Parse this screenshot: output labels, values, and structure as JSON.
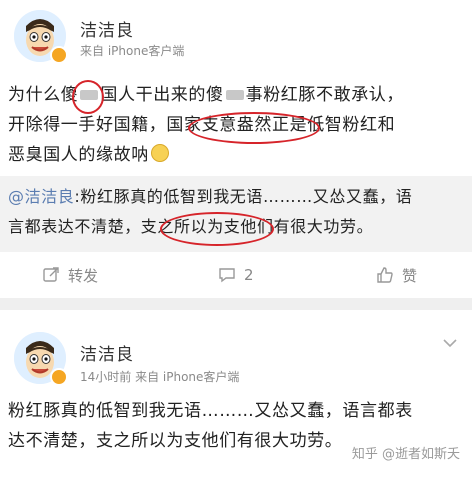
{
  "post1": {
    "username": "洁洁良",
    "meta": "来自 iPhone客户端",
    "lines": [
      "为什么傻",
      "国人干出来的傻",
      "事粉红豚不敢承认，",
      "开除得一手好国籍，国家支意盎然正是低智粉红和",
      "恶臭国人的缘故呐"
    ],
    "repost": {
      "mention": "@洁洁良",
      "line1": ":粉红豚真的低智到我无语………又怂又蠢，语",
      "line2": "言都表达不清楚，支之所以为支他们有很大功劳。"
    },
    "actions": {
      "repost_label": "转发",
      "comment_count": "2",
      "like_label": "赞"
    }
  },
  "post2": {
    "username": "洁洁良",
    "meta": "14小时前  来自 iPhone客户端",
    "line1": "粉红豚真的低智到我无语………又怂又蠢，语言都表",
    "line2": "达不清楚，支之所以为支他们有很大功劳。"
  },
  "watermark": "知乎 @逝者如斯夭",
  "colors": {
    "annotation_red": "#d6242a",
    "link_blue": "#5b7db1",
    "badge_orange": "#f5a623"
  }
}
